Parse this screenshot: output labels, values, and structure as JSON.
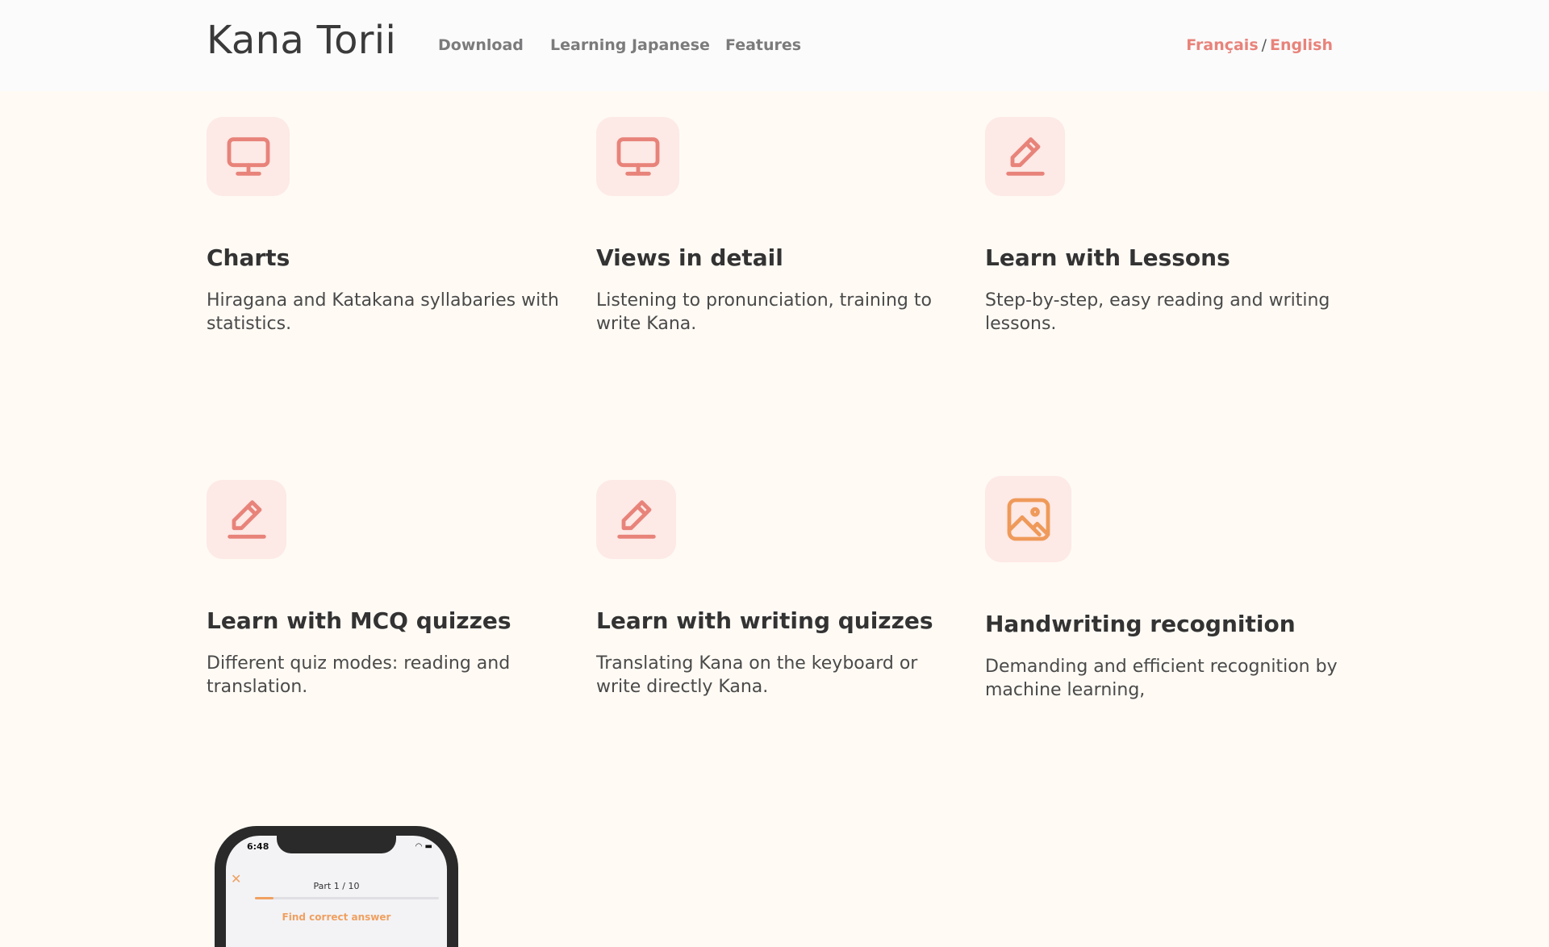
{
  "header": {
    "logo": "Kana Torii",
    "nav": [
      {
        "label": "Download"
      },
      {
        "label": "Learning Japanese"
      },
      {
        "label": "Features"
      }
    ],
    "lang": {
      "fr": "Français",
      "sep": "/",
      "en": "English"
    }
  },
  "features": [
    {
      "icon": "monitor-icon",
      "title": "Charts",
      "desc": "Hiragana and Katakana syllabaries with statistics."
    },
    {
      "icon": "monitor-icon",
      "title": "Views in detail",
      "desc": "Listening to pronunciation, training to write Kana."
    },
    {
      "icon": "pencil-icon",
      "title": "Learn with Lessons",
      "desc": "Step-by-step, easy reading and writing lessons."
    },
    {
      "icon": "pencil-icon",
      "title": "Learn with MCQ quizzes",
      "desc": "Different quiz modes: reading and translation."
    },
    {
      "icon": "pencil-icon",
      "title": "Learn with writing quizzes",
      "desc": "Translating Kana on the keyboard or write directly Kana."
    },
    {
      "icon": "image-icon",
      "title": "Handwriting recognition",
      "desc": "Demanding and efficient recognition by machine learning,"
    }
  ],
  "phone": {
    "time": "6:48",
    "part": "Part 1 / 10",
    "close": "✕",
    "prompt": "Find correct answer",
    "progress": 0.1
  },
  "colors": {
    "accent": "#e8837a",
    "icon_bg": "#fde9e6",
    "icon_orange": "#ef9a5a",
    "page_bg": "#fffaf4",
    "header_bg": "#fbfbfc"
  }
}
